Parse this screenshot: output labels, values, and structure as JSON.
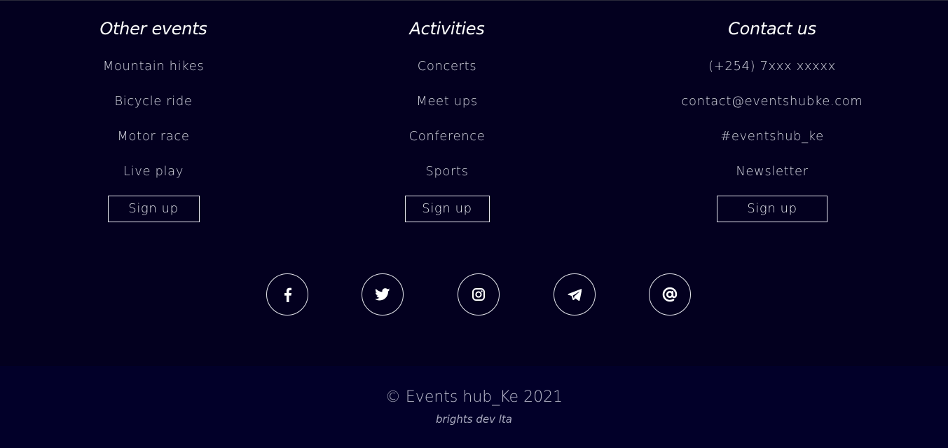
{
  "footer": {
    "columns": [
      {
        "title": "Other events",
        "items": [
          "Mountain hikes",
          "Bicycle ride",
          "Motor race",
          "Live play"
        ],
        "button": "Sign up"
      },
      {
        "title": "Activities",
        "items": [
          "Concerts",
          "Meet ups",
          "Conference",
          "Sports"
        ],
        "button": "Sign up"
      },
      {
        "title": "Contact us",
        "items": [
          "(+254) 7xxx xxxxx",
          "contact@eventshubke.com",
          "#eventshub_ke",
          "Newsletter"
        ],
        "button": "Sign up"
      }
    ],
    "social": [
      "facebook-icon",
      "twitter-icon",
      "instagram-icon",
      "telegram-icon",
      "at-sign-icon"
    ],
    "copyright": "© Events hub_Ke 2021",
    "credit": "brights dev lta"
  },
  "colors": {
    "background": "#03001f",
    "bottom_bar": "#020029",
    "text": "#d6d6e2",
    "border": "#e6e6ee"
  }
}
